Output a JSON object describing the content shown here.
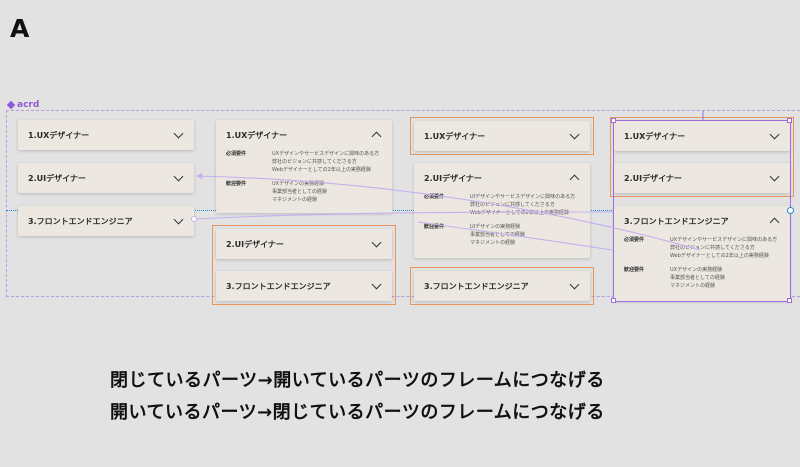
{
  "page_letter": "A",
  "frame_name": "acrd",
  "captions": [
    "閉じているパーツ→開いているパーツのフレームにつなげる",
    "開いているパーツ→閉じているパーツのフレームにつなげる"
  ],
  "items": {
    "ux": "1.UXデザイナー",
    "ui": "2.UIデザイナー",
    "fe": "3.フロントエンドエンジニア"
  },
  "labels": {
    "required": "必須要件",
    "welcome": "歓迎要件"
  },
  "ux_required": [
    "UXデザインやサービスデザインに興味のある方",
    "弊社のビジョンに共感してくださる方",
    "Webデザイナーとしての2年以上の実務経験"
  ],
  "ux_welcome": [
    "UXデザインの実務経験",
    "事業部当者としての経験",
    "マネジメントの経験"
  ],
  "ui_required": [
    "UIデザインやサービスデザインに興味のある方",
    "弊社のビジョンに共感してくださる方",
    "Webデザイナーとしての2年以上の実務経験"
  ],
  "ui_welcome": [
    "UIデザインの実務経験",
    "事業部当者としての経験",
    "マネジメントの経験"
  ],
  "fe_required": [
    "UXデザインやサービスデザインに興味のある方",
    "弊社のビジョンに共感してくださる方",
    "Webデザイナーとしての2年以上の実務経験"
  ],
  "fe_welcome": [
    "UXデザインの実務経験",
    "事業部当者としての経験",
    "マネジメントの経験"
  ],
  "colors": {
    "frame": "#8e5bd6",
    "orange_highlight": "#e8955b",
    "selection": "#9d6ce0",
    "guide": "#1e8ed6"
  }
}
